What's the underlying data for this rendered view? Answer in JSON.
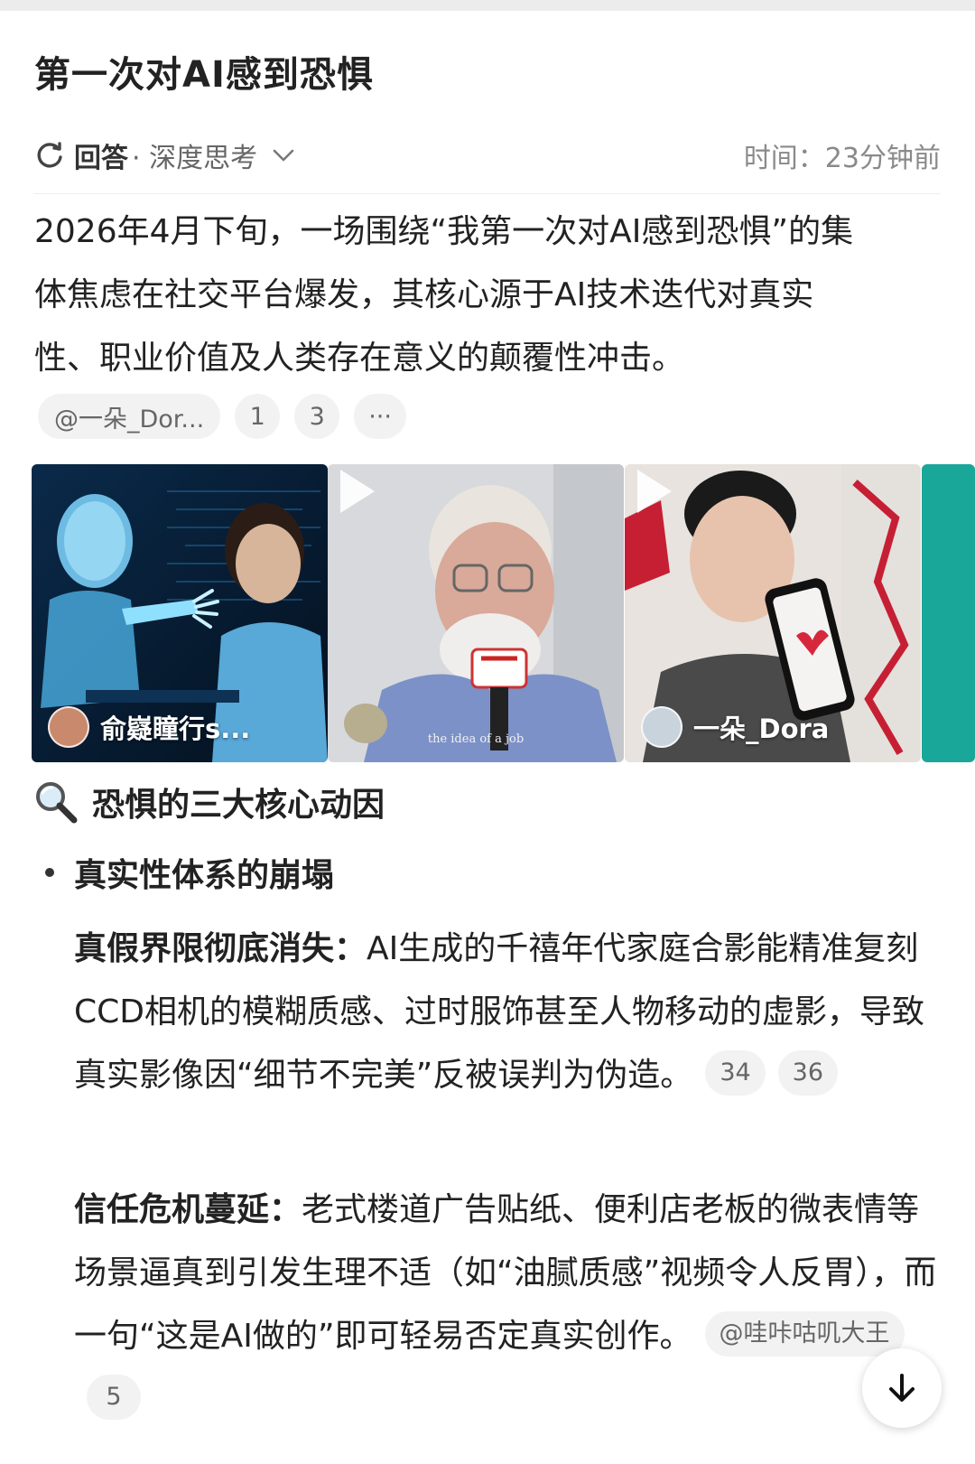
{
  "title": "第一次对AI感到恐惧",
  "meta": {
    "answer_label": "回答",
    "mode_label": "· 深度思考",
    "time_text": "时间：23分钟前"
  },
  "intro": {
    "line1": "2026年4月下旬，一场围绕“我第一次对AI感到恐惧”的集",
    "line2": "体焦虑在社交平台爆发，其核心源于AI技术迭代对真实",
    "line3": "性、职业价值及人类存在意义的颠覆性冲击。"
  },
  "source_chips": [
    "@一朵_Dor...",
    "1",
    "3",
    "···"
  ],
  "gallery": {
    "items": [
      {
        "caption": "俞嶷瞳行s...",
        "kind": "image"
      },
      {
        "caption": "",
        "subtitle": "the idea of a job",
        "kind": "video"
      },
      {
        "caption": "一朵_Dora",
        "kind": "video"
      }
    ]
  },
  "section": {
    "icon": "magnifier-icon",
    "heading": "恐惧的三大核心动因"
  },
  "bullet1": {
    "heading": "真实性体系的崩塌"
  },
  "sub1": {
    "bold": "真假界限彻底消失：",
    "text": "AI生成的千禧年代家庭合影能精准复刻CCD相机的模糊质感、过时服饰甚至人物移动的虚影，导致真实影像因“细节不完美”反被误判为伪造。",
    "chips": [
      "34",
      "36"
    ]
  },
  "sub2": {
    "bold": "信任危机蔓延：",
    "text": "老式楼道广告贴纸、便利店老板的微表情等场景逼真到引发生理不适（如“油腻质感”视频令人反胃），而一句“这是AI做的”即可轻易否定真实创作。",
    "chips": [
      "@哇咔咕叽大王",
      "5"
    ]
  },
  "colors": {
    "text": "#222222",
    "muted": "#8a8a8a",
    "chip_bg": "#f2f2f2"
  }
}
